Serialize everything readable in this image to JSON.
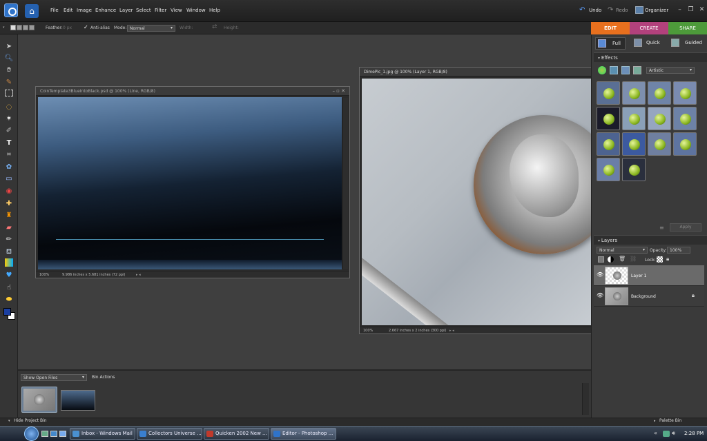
{
  "menubar": {
    "items": [
      "File",
      "Edit",
      "Image",
      "Enhance",
      "Layer",
      "Select",
      "Filter",
      "View",
      "Window",
      "Help"
    ],
    "undo": "Undo",
    "redo": "Redo",
    "organizer": "Organizer"
  },
  "options": {
    "feather_label": "Feather:",
    "feather_value": "0 px",
    "antialias_label": "Anti-alias",
    "mode_label": "Mode:",
    "mode_value": "Normal",
    "width_label": "Width:",
    "height_label": "Height:"
  },
  "tabs": {
    "edit": "EDIT",
    "create": "CREATE",
    "share": "SHARE"
  },
  "view_tabs": {
    "full": "Full",
    "quick": "Quick",
    "guided": "Guided"
  },
  "effects": {
    "title": "Effects",
    "category": "Artistic",
    "apply": "Apply"
  },
  "layers": {
    "title": "Layers",
    "blend_mode": "Normal",
    "opacity_label": "Opacity:",
    "opacity_value": "100%",
    "lock_label": "Lock:",
    "items": [
      {
        "name": "Layer 1"
      },
      {
        "name": "Background"
      }
    ]
  },
  "doc1": {
    "title": "CoinTemplate3BlueIntoBlack.psd @ 100% (Line, RGB/8)",
    "zoom": "100%",
    "size": "9.986 inches x 5.681 inches (72 ppi)"
  },
  "doc2": {
    "title": "DimePic_1.jpg @ 100% (Layer 1, RGB/8)",
    "zoom": "100%",
    "size": "2.667 inches x 2 inches (300 ppi)"
  },
  "bin": {
    "show_label": "Show Open Files",
    "actions": "Bin Actions"
  },
  "status": {
    "hide_bin": "Hide Project Bin",
    "palette_bin": "Palette Bin"
  },
  "taskbar": {
    "items": [
      {
        "label": "Inbox - Windows Mail",
        "color": "#4a90d0"
      },
      {
        "label": "Collectors Universe ...",
        "color": "#3a7fcf"
      },
      {
        "label": "Quicken 2002 New ...",
        "color": "#c0392b"
      },
      {
        "label": "Editor - Photoshop ...",
        "color": "#2f73c9"
      }
    ],
    "clock": "2:28 PM"
  },
  "colors": {
    "edit_tab": "#e8701e",
    "create_tab": "#b2417c",
    "share_tab": "#4d9a3a",
    "foreground": "#1b3fa0",
    "background": "#ffffff"
  },
  "icons": [
    "move-icon",
    "zoom-icon",
    "hand-icon",
    "eyedropper-icon",
    "marquee-icon",
    "lasso-icon",
    "magic-wand-icon",
    "selection-brush-icon",
    "type-icon",
    "crop-icon",
    "cookie-cutter-icon",
    "straighten-icon",
    "red-eye-icon",
    "healing-brush-icon",
    "clone-stamp-icon",
    "eraser-icon",
    "brush-icon",
    "paint-bucket-icon",
    "gradient-icon",
    "shape-icon",
    "blur-icon",
    "sponge-icon"
  ]
}
